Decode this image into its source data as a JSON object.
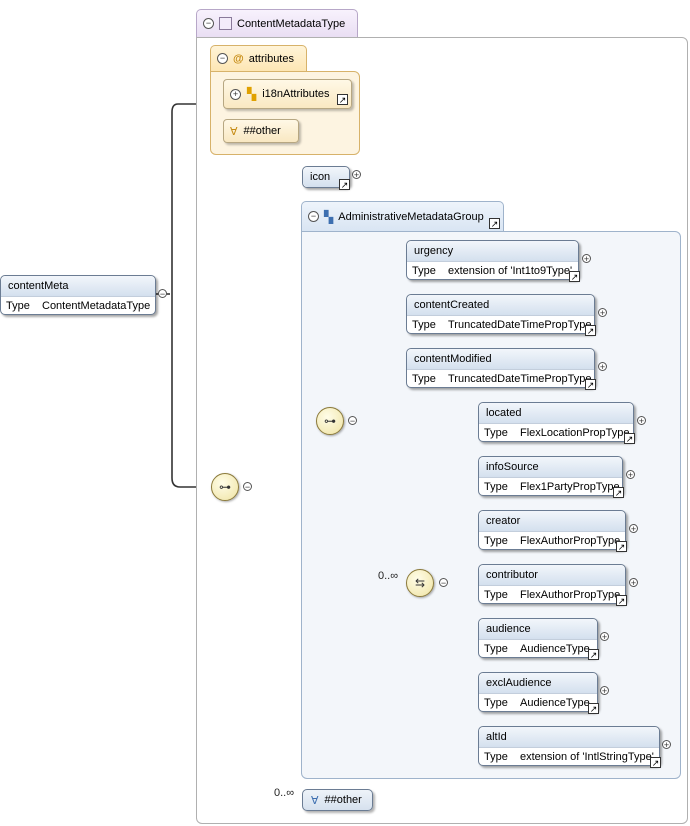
{
  "complex_type": {
    "name": "ContentMetadataType",
    "minus": "⊖"
  },
  "attributes": {
    "label": "attributes",
    "group_ref": "i18nAttributes",
    "any_attr": "##other"
  },
  "root_element": {
    "name": "contentMeta",
    "type_key": "Type",
    "type_value": "ContentMetadataType"
  },
  "icon_element": {
    "name": "icon"
  },
  "group": {
    "name": "AdministrativeMetadataGroup"
  },
  "group_elements": [
    {
      "name": "urgency",
      "type_key": "Type",
      "type_value": "extension of 'Int1to9Type'"
    },
    {
      "name": "contentCreated",
      "type_key": "Type",
      "type_value": "TruncatedDateTimePropType"
    },
    {
      "name": "contentModified",
      "type_key": "Type",
      "type_value": "TruncatedDateTimePropType"
    }
  ],
  "choice_occurrence": "0..∞",
  "choice_elements": [
    {
      "name": "located",
      "type_key": "Type",
      "type_value": "FlexLocationPropType"
    },
    {
      "name": "infoSource",
      "type_key": "Type",
      "type_value": "Flex1PartyPropType"
    },
    {
      "name": "creator",
      "type_key": "Type",
      "type_value": "FlexAuthorPropType"
    },
    {
      "name": "contributor",
      "type_key": "Type",
      "type_value": "FlexAuthorPropType"
    },
    {
      "name": "audience",
      "type_key": "Type",
      "type_value": "AudienceType"
    },
    {
      "name": "exclAudience",
      "type_key": "Type",
      "type_value": "AudienceType"
    },
    {
      "name": "altId",
      "type_key": "Type",
      "type_value": "extension of 'IntlStringType'"
    }
  ],
  "any_element": {
    "occurrence": "0..∞",
    "label": "##other"
  },
  "icons": {
    "collapse": "collapse-icon",
    "expand": "expand-icon",
    "reference": "reference-arrow-icon",
    "sequence": "sequence-compositor-icon",
    "choice": "choice-compositor-icon"
  },
  "colors": {
    "attribute_bg": "#fdf4e1",
    "group_bg": "#f3f6fa",
    "element_header": "#d4e0ee"
  }
}
